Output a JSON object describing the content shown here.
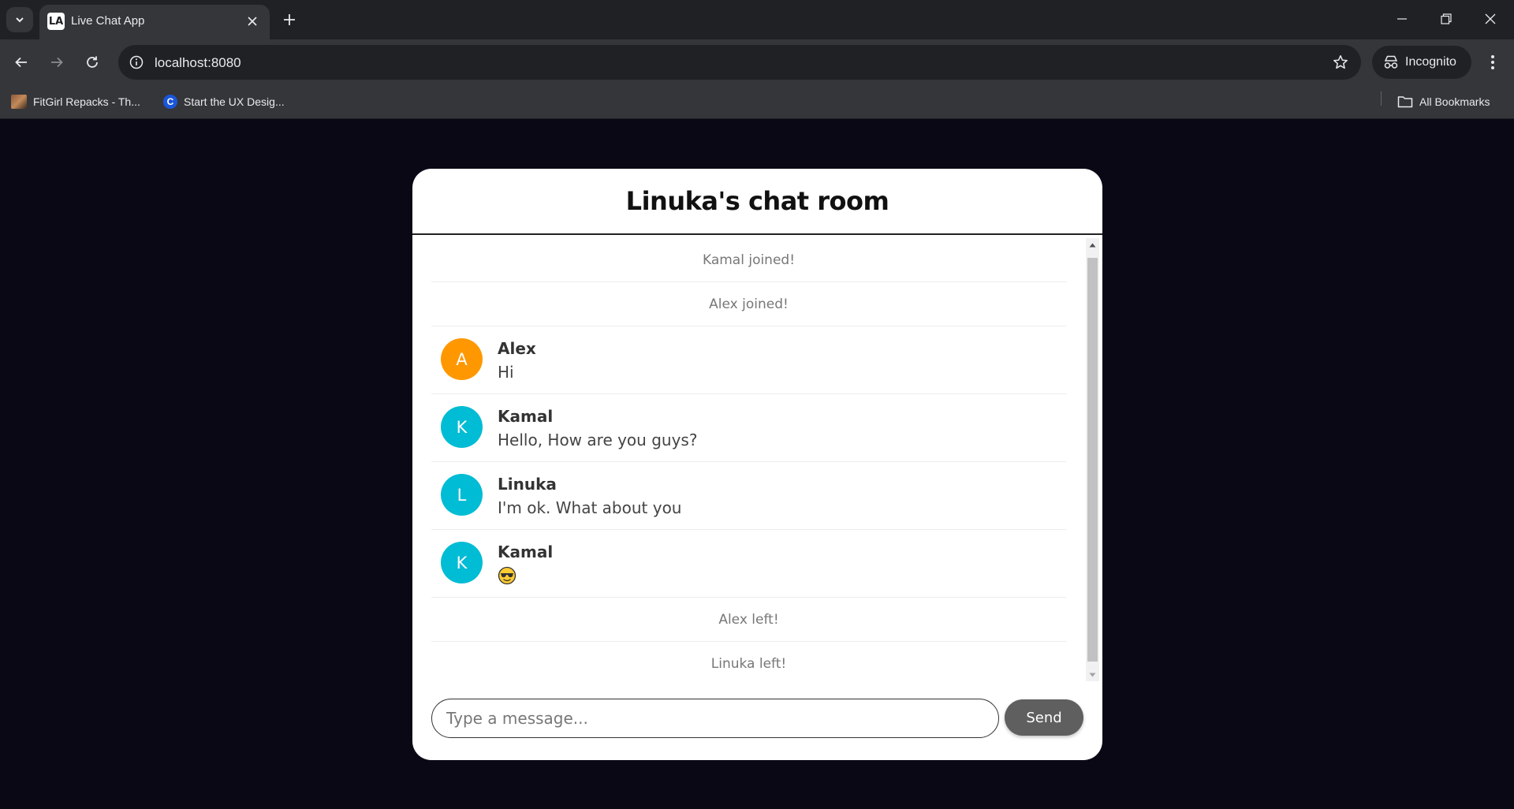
{
  "browser": {
    "tab_title": "Live Chat App",
    "favicon_text": "LA",
    "url": "localhost:8080",
    "incognito_label": "Incognito",
    "bookmarks": [
      {
        "label": "FitGirl Repacks - Th...",
        "icon": "site-thumbnail"
      },
      {
        "label": "Start the UX Desig...",
        "icon": "c-logo",
        "icon_text": "C"
      }
    ],
    "all_bookmarks_label": "All Bookmarks"
  },
  "chat": {
    "title": "Linuka's chat room",
    "messages": [
      {
        "type": "system",
        "text": "Kamal joined!"
      },
      {
        "type": "system",
        "text": "Alex joined!"
      },
      {
        "type": "chat",
        "initial": "A",
        "sender": "Alex",
        "text": "Hi",
        "avatar_color": "#ff9800"
      },
      {
        "type": "chat",
        "initial": "K",
        "sender": "Kamal",
        "text": "Hello, How are you guys?",
        "avatar_color": "#00bcd4"
      },
      {
        "type": "chat",
        "initial": "L",
        "sender": "Linuka",
        "text": "I'm ok. What about you",
        "avatar_color": "#00bcd4"
      },
      {
        "type": "chat",
        "initial": "K",
        "sender": "Kamal",
        "emoji": "smiling-face-with-sunglasses",
        "avatar_color": "#00bcd4"
      },
      {
        "type": "system",
        "text": "Alex left!"
      },
      {
        "type": "system",
        "text": "Linuka left!"
      }
    ],
    "input_placeholder": "Type a message...",
    "send_label": "Send"
  },
  "colors": {
    "page_background": "#0b0816",
    "card_background": "#ffffff",
    "send_button": "#5f5f5f",
    "avatar_orange": "#ff9800",
    "avatar_cyan": "#00bcd4"
  }
}
